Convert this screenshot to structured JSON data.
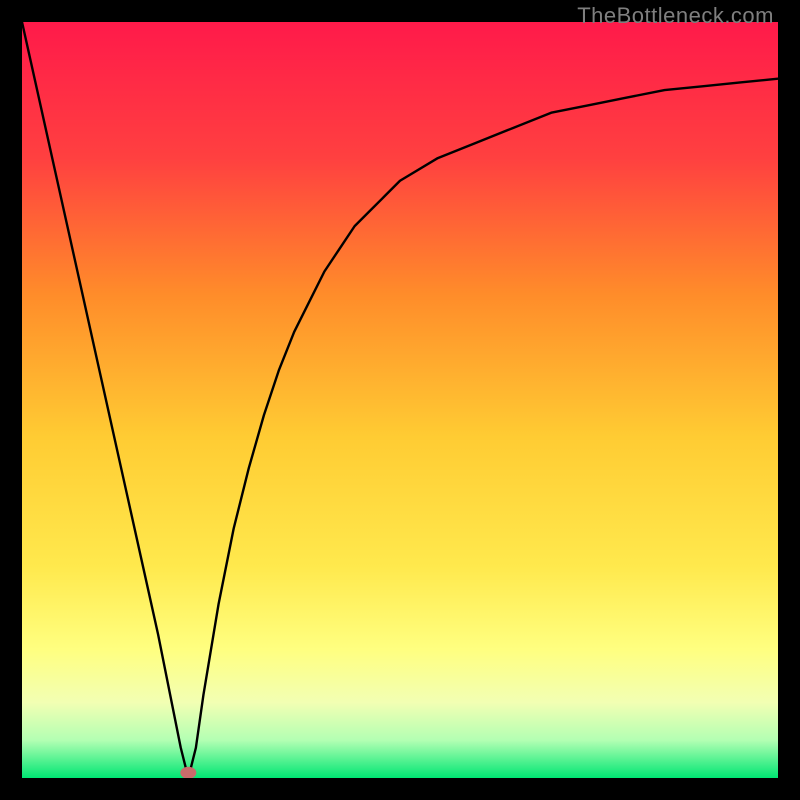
{
  "watermark": "TheBottleneck.com",
  "chart_data": {
    "type": "line",
    "title": "",
    "xlabel": "",
    "ylabel": "",
    "xlim": [
      0,
      100
    ],
    "ylim": [
      0,
      100
    ],
    "grid": false,
    "legend": false,
    "background_gradient": {
      "top": "#ff1a4a",
      "mid_upper": "#ff7f2a",
      "mid": "#ffd633",
      "mid_lower": "#ffff66",
      "lower": "#e6ffb3",
      "bottom": "#00e673"
    },
    "series": [
      {
        "name": "curve",
        "x": [
          0,
          2,
          4,
          6,
          8,
          10,
          12,
          14,
          16,
          18,
          20,
          21,
          22,
          23,
          24,
          26,
          28,
          30,
          32,
          34,
          36,
          38,
          40,
          42,
          44,
          46,
          48,
          50,
          55,
          60,
          65,
          70,
          75,
          80,
          85,
          90,
          95,
          100
        ],
        "y": [
          100,
          91,
          82,
          73,
          64,
          55,
          46,
          37,
          28,
          19,
          9,
          4,
          0,
          4,
          11,
          23,
          33,
          41,
          48,
          54,
          59,
          63,
          67,
          70,
          73,
          75,
          77,
          79,
          82,
          84,
          86,
          88,
          89,
          90,
          91,
          91.5,
          92,
          92.5
        ]
      }
    ],
    "marker": {
      "x": 22,
      "y": 0.7,
      "color": "#c96b6b",
      "shape": "pill"
    }
  }
}
